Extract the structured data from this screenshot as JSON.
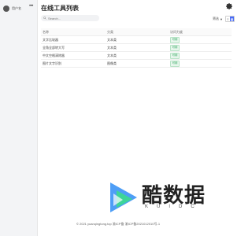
{
  "sidebar": {
    "brand_label": "用户名",
    "more": "•••"
  },
  "header": {
    "title": "在线工具列表"
  },
  "search": {
    "placeholder": "Search..."
  },
  "toolbar": {
    "filter_label": "筛选",
    "filter_icon": "funnel-icon",
    "view_list": "≡",
    "view_grid": "▦"
  },
  "table": {
    "columns": [
      "名称",
      "分类",
      "访问力度"
    ],
    "rows": [
      {
        "name": "文字比较器",
        "category": "文本类",
        "status": "可用"
      },
      {
        "name": "全角全部转大写",
        "category": "文本类",
        "status": "可用"
      },
      {
        "name": "中文空格清除器",
        "category": "文本类",
        "status": "可用"
      },
      {
        "name": "图片文字识别",
        "category": "图像类",
        "status": "可用"
      }
    ]
  },
  "footer": {
    "text": "© 2021 yuanqingtong.top 渝ICP备 渝ICP备2021012010号-1"
  },
  "watermark": {
    "title": "酷数据",
    "subtitle": "KUIDC"
  },
  "colors": {
    "accent": "#4a6cf7",
    "badge_green": "#2aa35a",
    "logo_blue": "#2f8df5",
    "logo_green": "#3ed598"
  }
}
